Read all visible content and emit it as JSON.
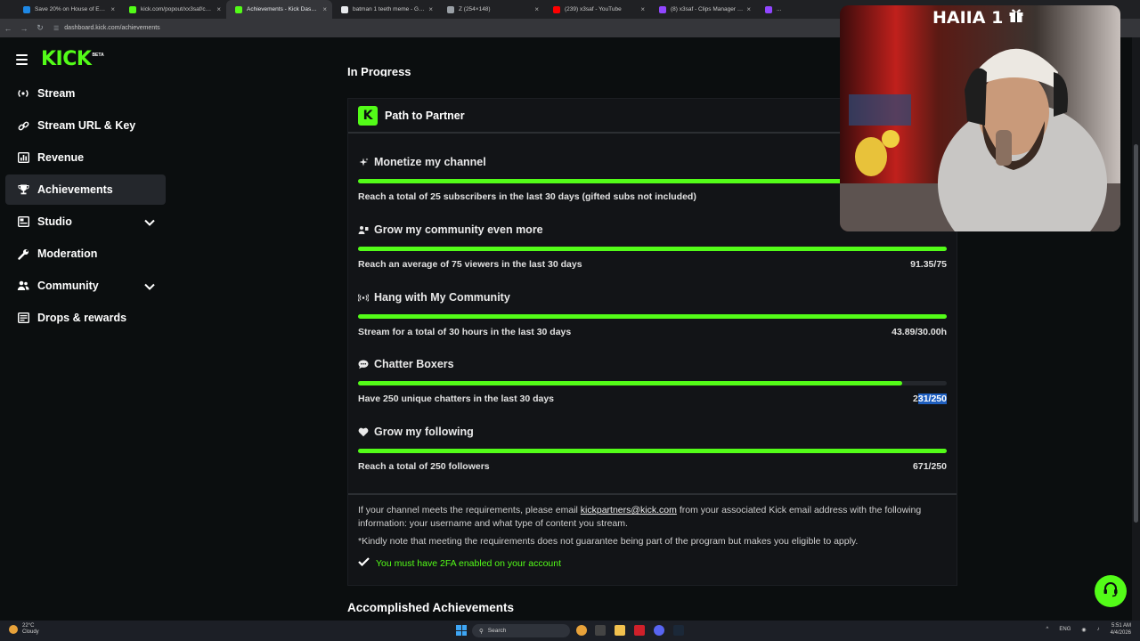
{
  "browser": {
    "tabs": [
      {
        "title": "Save 20% on House of Empty",
        "color": "#1e88e5"
      },
      {
        "title": "kick.com/popout/xx3saf/chat",
        "color": "#53fc18"
      },
      {
        "title": "Achievements - Kick Dashboard",
        "color": "#53fc18",
        "active": true
      },
      {
        "title": "batman 1 teeth meme - Googl",
        "color": "#e8eaed"
      },
      {
        "title": "Z (254×148)",
        "color": "#9aa0a6"
      },
      {
        "title": "(239) x3saf - YouTube",
        "color": "#ff0000"
      },
      {
        "title": "(8) x3saf - Clips Manager - Twi",
        "color": "#9146ff"
      },
      {
        "title": "...",
        "color": "#9146ff"
      }
    ],
    "url": "dashboard.kick.com/achievements"
  },
  "brand": {
    "logo": "KICK",
    "badge": "BETA",
    "accent": "#53fc18"
  },
  "sidebar": {
    "items": [
      {
        "label": "Stream",
        "icon": "broadcast-icon"
      },
      {
        "label": "Stream URL & Key",
        "icon": "link-icon"
      },
      {
        "label": "Revenue",
        "icon": "chart-icon"
      },
      {
        "label": "Achievements",
        "icon": "trophy-icon"
      },
      {
        "label": "Studio",
        "icon": "studio-icon"
      },
      {
        "label": "Moderation",
        "icon": "wrench-icon"
      },
      {
        "label": "Community",
        "icon": "people-icon"
      },
      {
        "label": "Drops & rewards",
        "icon": "gift-icon"
      }
    ]
  },
  "main": {
    "section_title": "In Progress",
    "card_title": "Path to Partner",
    "goals": [
      {
        "title": "Monetize my channel",
        "desc": "Reach a total of 25 subscribers in the last 30 days (gifted subs not included)",
        "value": "",
        "progress": 1.0,
        "icon": "sparkle-icon"
      },
      {
        "title": "Grow my community even more",
        "desc": "Reach an average of 75 viewers in the last 30 days",
        "value": "91.35/75",
        "progress": 1.0,
        "icon": "community-icon"
      },
      {
        "title": "Hang with My Community",
        "desc": "Stream for a total of 30 hours in the last 30 days",
        "value": "43.89/30.00h",
        "progress": 1.0,
        "icon": "signal-icon"
      },
      {
        "title": "Chatter Boxers",
        "desc": "Have 250 unique chatters in the last 30 days",
        "value_plain": "2",
        "value_selected": "31/250",
        "progress": 0.924,
        "icon": "chat-icon"
      },
      {
        "title": "Grow my following",
        "desc": "Reach a total of 250 followers",
        "value": "671/250",
        "progress": 1.0,
        "icon": "heart-icon"
      }
    ],
    "info_pre": "If your channel meets the requirements, please email ",
    "info_email": "kickpartners@kick.com",
    "info_post": " from your associated Kick email address with the following information: your username and what type of content you stream.",
    "note": "*Kindly note that meeting the requirements does not guarantee being part of the program but makes you eligible to apply.",
    "requirement": "You must have 2FA enabled on your account",
    "accomplished_title": "Accomplished Achievements"
  },
  "overlay": {
    "tag": "HAIIA 1"
  },
  "taskbar": {
    "weather_temp": "22°C",
    "weather_desc": "Cloudy",
    "search_placeholder": "Search",
    "lang": "ENG",
    "time": "5:51 AM",
    "date": "4/4/2026"
  }
}
